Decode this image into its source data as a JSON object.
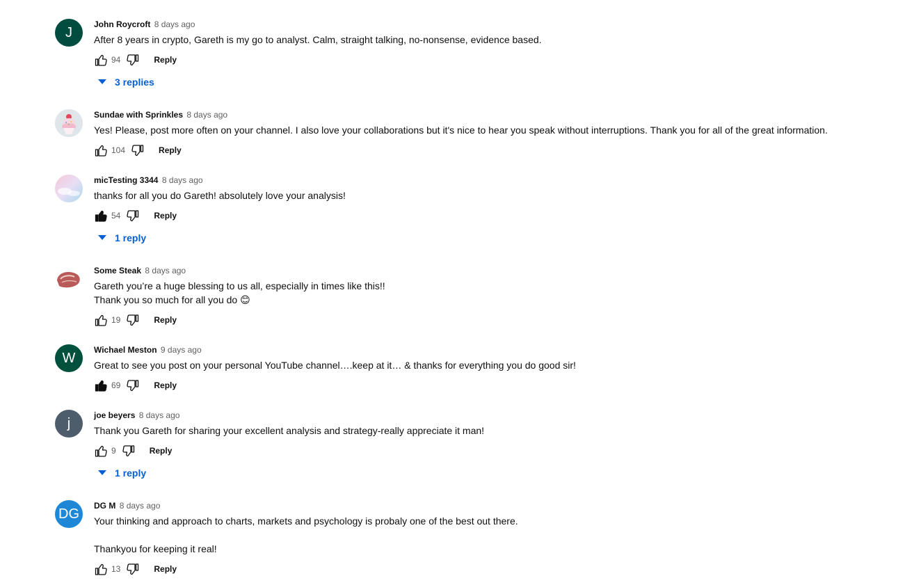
{
  "comments": [
    {
      "author": "John Roycroft",
      "time": "8 days ago",
      "text": "After 8 years in crypto, Gareth is my go to analyst. Calm, straight talking, no-nonsense, evidence based.",
      "likes": "94",
      "liked": false,
      "reply_label": "Reply",
      "replies_label": "3 replies",
      "avatar": {
        "letter": "J",
        "color": "#004d40"
      }
    },
    {
      "author": "Sundae with Sprinkles",
      "time": "8 days ago",
      "text": "Yes! Please, post more often on your channel.  I also love your collaborations but it's nice to hear you speak without interruptions. Thank you for all of the great information.",
      "likes": "104",
      "liked": false,
      "reply_label": "Reply",
      "replies_label": "",
      "avatar": {
        "letter": "",
        "color": "#dfe6ea"
      }
    },
    {
      "author": "micTesting 3344",
      "time": "8 days ago",
      "text": "thanks for all you do Gareth! absolutely love your analysis!",
      "likes": "54",
      "liked": true,
      "reply_label": "Reply",
      "replies_label": "1 reply",
      "avatar": {
        "letter": "",
        "color": "#f3c8d6"
      }
    },
    {
      "author": "Some Steak",
      "time": "8 days ago",
      "text": "Gareth you’re a huge blessing to us all, especially in times like this!!\nThank you so much for all you do 😊",
      "likes": "19",
      "liked": false,
      "reply_label": "Reply",
      "replies_label": "",
      "avatar": {
        "letter": "",
        "color": "#ffffff"
      }
    },
    {
      "author": "Wichael Meston",
      "time": "9 days ago",
      "text": "Great to see you post on your personal YouTube channel….keep at it… & thanks for everything you do good sir!",
      "likes": "69",
      "liked": true,
      "reply_label": "Reply",
      "replies_label": "",
      "avatar": {
        "letter": "W",
        "color": "#00503e"
      }
    },
    {
      "author": "joe beyers",
      "time": "8 days ago",
      "text": "Thank you Gareth for sharing your excellent analysis and strategy-really appreciate it man!",
      "likes": "9",
      "liked": false,
      "reply_label": "Reply",
      "replies_label": "1 reply",
      "avatar": {
        "letter": "j",
        "color": "#4e5d6c"
      }
    },
    {
      "author": "DG M",
      "time": "8 days ago",
      "text": "Your thinking and approach to charts, markets and psychology is probaly one of the best out there.\n\nThankyou for keeping it real!",
      "likes": "13",
      "liked": false,
      "reply_label": "Reply",
      "replies_label": "",
      "avatar": {
        "letter": "DG",
        "color": "#1e88d6"
      }
    }
  ]
}
